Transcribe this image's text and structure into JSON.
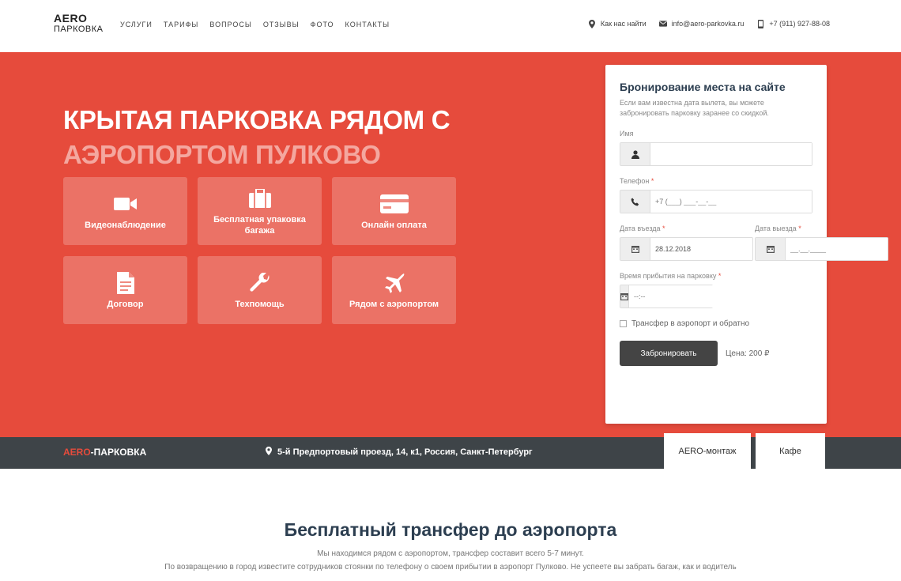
{
  "header": {
    "logo_line1": "AERO",
    "logo_line2": "ПАРКОВКА",
    "nav": [
      "УСЛУГИ",
      "ТАРИФЫ",
      "ВОПРОСЫ",
      "ОТЗЫВЫ",
      "ФОТО",
      "КОНТАКТЫ"
    ],
    "contacts": {
      "directions": "Как нас найти",
      "email": "info@aero-parkovka.ru",
      "phone": "+7 (911) 927-88-08"
    }
  },
  "hero": {
    "title_line1": "КРЫТАЯ ПАРКОВКА РЯДОМ С",
    "title_line2": "АЭРОПОРТОМ ПУЛКОВО",
    "features": [
      {
        "label": "Видеонаблюдение",
        "icon": "video-camera-icon"
      },
      {
        "label": "Бесплатная упаковка багажа",
        "icon": "suitcase-icon"
      },
      {
        "label": "Онлайн оплата",
        "icon": "credit-card-icon"
      },
      {
        "label": "Договор",
        "icon": "document-icon"
      },
      {
        "label": "Техпомощь",
        "icon": "wrench-icon"
      },
      {
        "label": "Рядом с аэропортом",
        "icon": "airplane-icon"
      }
    ]
  },
  "booking": {
    "title": "Бронирование места на сайте",
    "description": "Если вам известна дата вылета, вы можете забронировать парковку заранее со скидкой.",
    "name_label": "Имя",
    "name_value": "",
    "phone_label": "Телефон",
    "phone_placeholder": "+7 (___) ___-__-__",
    "date_out_label": "Дата въезда",
    "date_out_value": "28.12.2018",
    "date_back_label": "Дата выезда",
    "date_back_placeholder": "__.__.____",
    "arrival_label": "Время прибытия на парковку",
    "arrival_placeholder": "--:--",
    "transfer_label": "Трансфер в аэропорт и обратно",
    "submit_label": "Забронировать",
    "price_label": "Цена: 200 ₽",
    "required_mark": "*"
  },
  "bar": {
    "logo_accent": "AERO",
    "logo_rest": "-ПАРКОВКА",
    "address": "5-й Предпортовый проезд, 14, к1, Россия, Санкт-Петербург",
    "tabs": [
      "AERO-монтаж",
      "Кафе"
    ]
  },
  "transfer": {
    "title": "Бесплатный трансфер до аэропорта",
    "line1": "Мы находимся рядом с аэропортом, трансфер составит всего 5-7 минут.",
    "line2": "По возвращению в город известите сотрудников стоянки по телефону о своем прибытии в аэропорт Пулково. Не успеете вы забрать багаж, как и водитель"
  },
  "colors": {
    "accent": "#e64b3c",
    "dark_bar": "#3e4448",
    "heading": "#2c3e50"
  }
}
